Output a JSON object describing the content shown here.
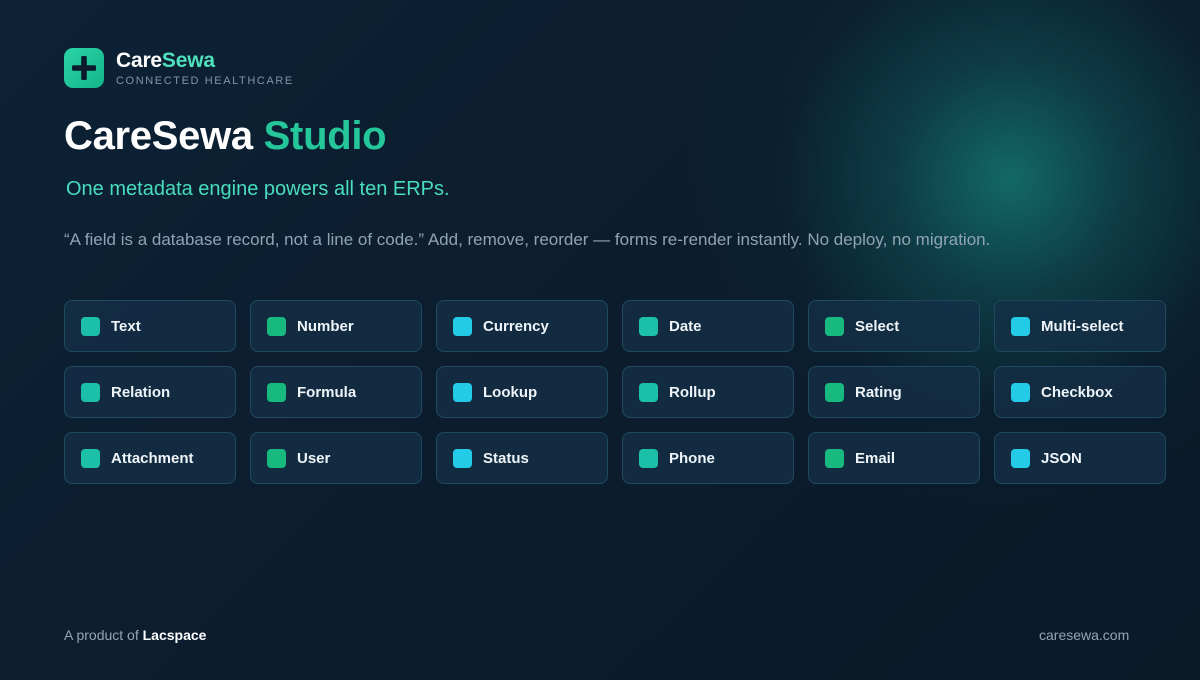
{
  "brand": {
    "name_part1": "Care",
    "name_part2": "Sewa",
    "tagline": "CONNECTED HEALTHCARE",
    "logo_icon": "plus-icon"
  },
  "headline": {
    "part1": "CareSewa",
    "part2": "Studio"
  },
  "subtitle": "One metadata engine powers all ten ERPs.",
  "quote": "“A field is a database record, not a line of code.” Add, remove, reorder — forms re-render instantly. No deploy, no migration.",
  "field_types": [
    [
      "Text",
      "Number",
      "Currency",
      "Date",
      "Select",
      "Multi-select"
    ],
    [
      "Relation",
      "Formula",
      "Lookup",
      "Rollup",
      "Rating",
      "Checkbox"
    ],
    [
      "Attachment",
      "User",
      "Status",
      "Phone",
      "Email",
      "JSON"
    ]
  ],
  "colors": {
    "background": "#0b1b2b",
    "accent_teal": "#1cbfa8",
    "accent_green": "#18b97e",
    "accent_cyan": "#24cbe7",
    "headline_accent": "#24c69a",
    "subtitle": "#48dcc0"
  },
  "footer": {
    "prefix": "A product of ",
    "company": "Lacspace",
    "url": "caresewa.com"
  }
}
